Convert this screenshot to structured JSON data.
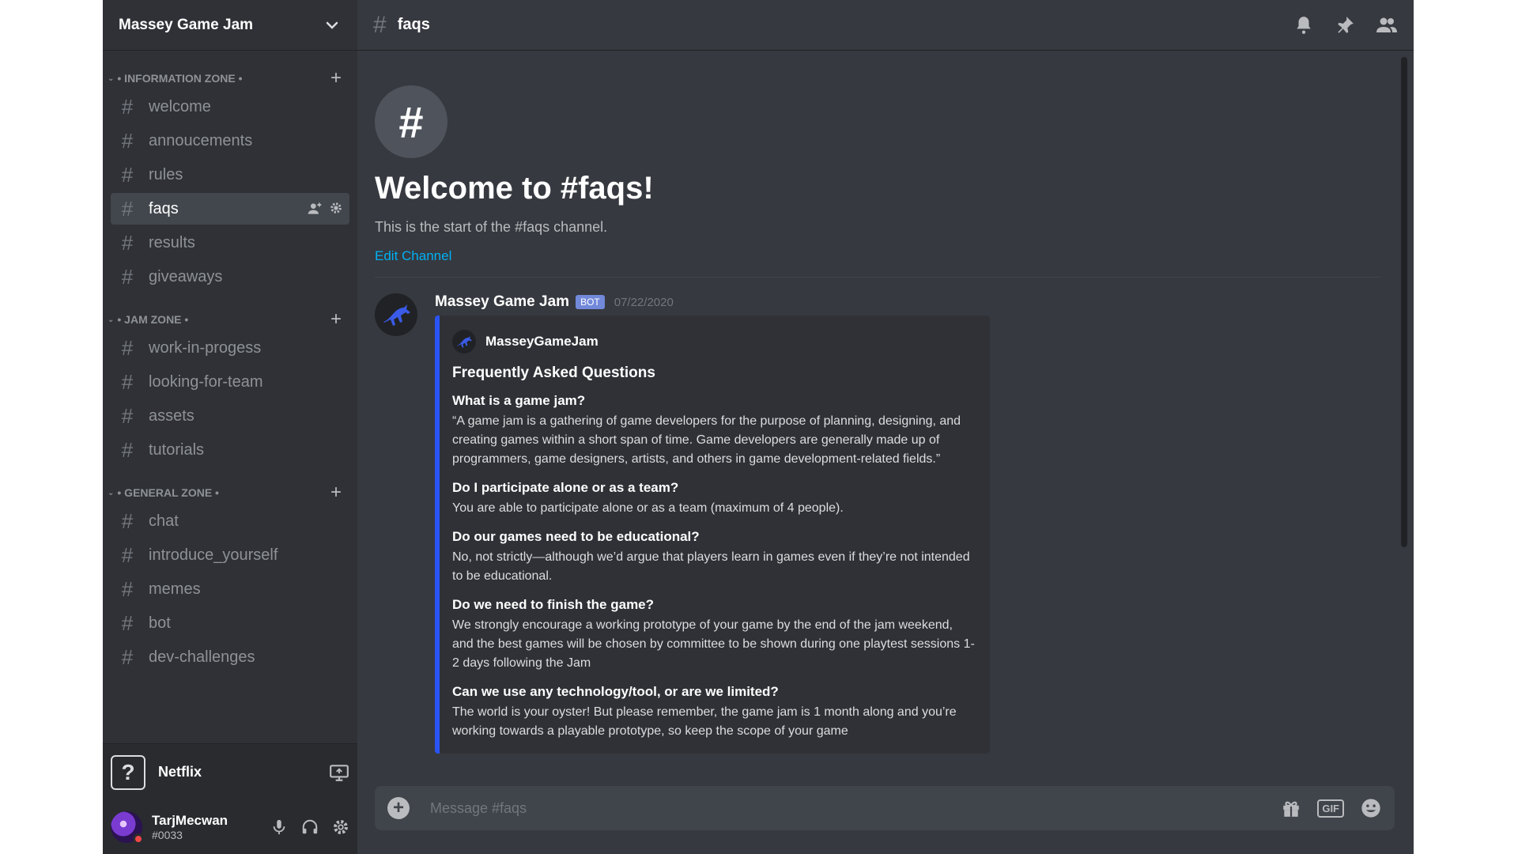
{
  "server": {
    "name": "Massey Game Jam"
  },
  "categories": [
    {
      "label": "• INFORMATION ZONE •",
      "channels": [
        "welcome",
        "annoucements",
        "rules",
        "faqs",
        "results",
        "giveaways"
      ]
    },
    {
      "label": "• JAM ZONE •",
      "channels": [
        "work-in-progess",
        "looking-for-team",
        "assets",
        "tutorials"
      ]
    },
    {
      "label": "• GENERAL ZONE •",
      "channels": [
        "chat",
        "introduce_yourself",
        "memes",
        "bot",
        "dev-challenges"
      ]
    }
  ],
  "active_channel": "faqs",
  "topbar": {
    "title": "faqs"
  },
  "welcome": {
    "title": "Welcome to #faqs!",
    "subtitle": "This is the start of the #faqs channel.",
    "edit_link": "Edit Channel"
  },
  "message": {
    "author": "Massey Game Jam",
    "badge": "BOT",
    "timestamp": "07/22/2020",
    "embed": {
      "author": "MasseyGameJam",
      "title": "Frequently Asked Questions",
      "faqs": [
        {
          "q": "What is a game jam?",
          "a": "“A game jam is a gathering of game developers for the purpose of planning, designing, and creating games within a short span of time. Game developers are generally made up of programmers, game designers, artists, and others in game development-related fields.”"
        },
        {
          "q": "Do I participate alone or as a team?",
          "a": "You are able to participate alone or as a team (maximum of 4 people)."
        },
        {
          "q": "Do our games need to be educational?",
          "a": "No, not strictly—although we’d argue that players learn in games even if they’re not intended to be educational."
        },
        {
          "q": "Do we need to finish the game?",
          "a": "We strongly encourage a working prototype of your game by the end of the jam weekend, and the best games will be chosen by committee to be shown during one playtest sessions 1-2 days following the Jam"
        },
        {
          "q": "Can we use any technology/tool, or are we limited?",
          "a": "The world is your oyster! But please remember, the game jam is 1 month along and you’re working towards a playable prototype, so keep the scope of your game"
        }
      ]
    }
  },
  "activity": {
    "icon": "?",
    "name": "Netflix"
  },
  "user": {
    "name": "TarjMecwan",
    "tag": "#0033"
  },
  "composer": {
    "placeholder": "Message #faqs",
    "gif_label": "GIF"
  }
}
